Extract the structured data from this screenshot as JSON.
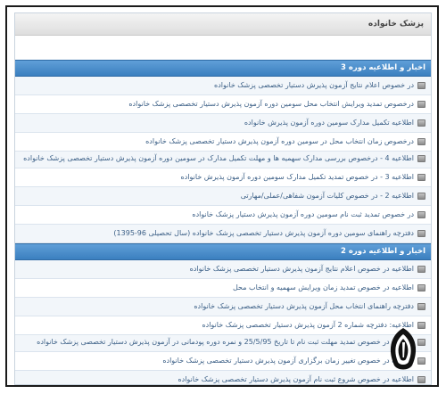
{
  "header": {
    "title": "پزشک خانواده"
  },
  "sections": [
    {
      "title": "اخبار و اطلاعیه دوره 3",
      "items": [
        "در خصوص اعلام نتایج آزمون پذیرش دستیار تخصصی پزشک خانواده",
        "درخصوص تمدید ویرایش انتخاب محل سومین دوره آزمون پذیرش دستیار تخصصی پزشک خانواده",
        "اطلاعیه تکمیل مدارک سومین دوره آزمون پذیرش خانواده",
        "درخصوص زمان انتخاب محل در سومین دوره آزمون پذیرش دستیار تخصصی پزشک خانواده",
        "اطلاعیه 4 - درخصوص بررسی مدارک سهمیه ها و مهلت تکمیل مدارک در سومین دوره آزمون پذیرش دستیار تخصصی پزشک خانواده",
        "اطلاعیه 3 - در خصوص تمدید تکمیل مدارک سومین دوره آزمون پذیرش خانواده",
        "اطلاعیه 2 - در خصوص کلیات آزمون شفاهی/عملی/مهارتی",
        "در خصوص تمدید ثبت نام سومین دوره آزمون پذیرش دستیار پزشک خانواده",
        "دفترچه راهنمای سومین دوره آزمون پذیرش دستیار تخصصی پزشک خانواده (سال تحصیلی 96-1395)"
      ]
    },
    {
      "title": "اخبار و اطلاعیه دوره 2",
      "items": [
        "اطلاعیه در خصوص اعلام نتایج آزمون پذیرش دستیار تخصصی پزشک خانواده",
        "اطلاعیه در خصوص تمدید زمان ویرایش سهمیه و انتخاب محل",
        "دفترچه راهنمای انتخاب محل آزمون پذیرش دستیار تخصصی پزشک خانواده",
        "اطلاعیه: دفترچه شماره 2 آزمون پذیرش دستیار تخصصی پزشک خانواده",
        "اطلاعیه در خصوص تمدید مهلت ثبت نام تا تاریخ 25/5/95 و نمره دوره پودمانی در آزمون پذیرش دستیار تخصصی پزشک خانواده",
        "اطلاعیه در خصوص تغییر زمان برگزاری آزمون پذیرش دستیار تخصصی پزشک خانواده",
        "اطلاعیه در خصوص شروع ثبت نام آزمون پذیرش دستیار تخصصی پزشک خانواده"
      ]
    }
  ]
}
